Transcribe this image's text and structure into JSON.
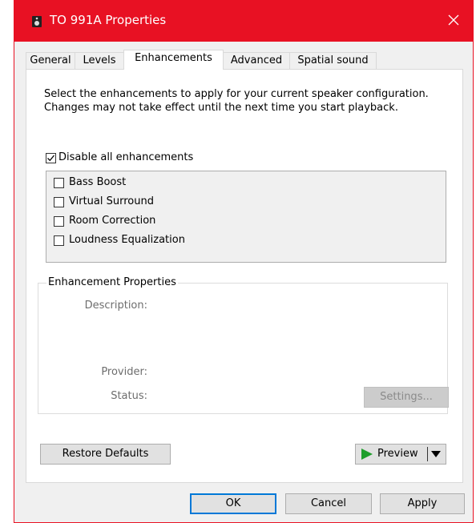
{
  "window": {
    "title": "TO 991A Properties",
    "close_label": "✕"
  },
  "tabs": [
    {
      "label": "General"
    },
    {
      "label": "Levels"
    },
    {
      "label": "Enhancements"
    },
    {
      "label": "Advanced"
    },
    {
      "label": "Spatial sound"
    }
  ],
  "enhancements": {
    "description": "Select the enhancements to apply for your current speaker configuration. Changes may not take effect until the next time you start playback.",
    "disable_all": {
      "label": "Disable all enhancements",
      "checked": true
    },
    "items": [
      {
        "label": "Bass Boost",
        "checked": false
      },
      {
        "label": "Virtual Surround",
        "checked": false
      },
      {
        "label": "Room Correction",
        "checked": false
      },
      {
        "label": "Loudness Equalization",
        "checked": false
      }
    ]
  },
  "properties": {
    "legend": "Enhancement Properties",
    "description_label": "Description:",
    "provider_label": "Provider:",
    "status_label": "Status:",
    "settings_label": "Settings..."
  },
  "actions": {
    "restore_defaults": "Restore Defaults",
    "preview": "Preview"
  },
  "footer": {
    "ok": "OK",
    "cancel": "Cancel",
    "apply": "Apply"
  },
  "colors": {
    "titlebar": "#e81123",
    "accent": "#0078d7",
    "play_green": "#1e9e2b"
  },
  "icons": {
    "title": "speaker-icon",
    "close": "close-icon",
    "preview": "play-icon",
    "dropdown": "dropdown-arrow-icon"
  }
}
